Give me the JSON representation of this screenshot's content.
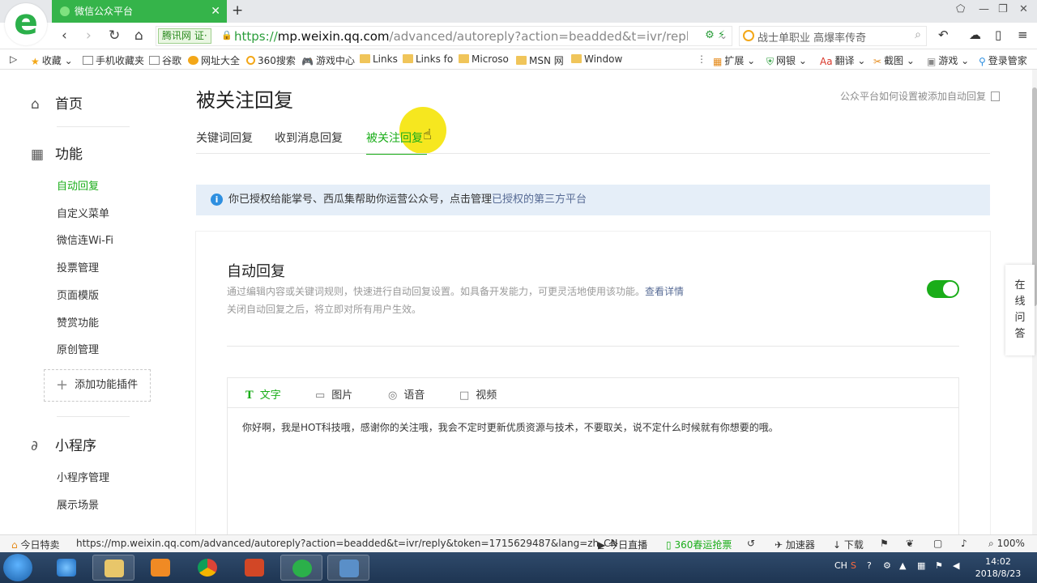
{
  "browser": {
    "tab_title": "微信公众平台",
    "site_badge": "腾讯网 证·",
    "url_scheme": "https://",
    "url_host": "mp.weixin.qq.com",
    "url_path": "/advanced/autoreply?action=beadded&t=ivr/reply&tc",
    "search_text": "战士单职业 高爆率传奇",
    "bookmarks": [
      "收藏",
      "手机收藏夹",
      "谷歌",
      "网址大全",
      "360搜索",
      "游戏中心",
      "Links",
      "Links fo",
      "Microso",
      "MSN 网",
      "Window"
    ],
    "right_bookmarks": [
      "扩展",
      "网银",
      "翻译",
      "截图",
      "游戏",
      "登录管家"
    ]
  },
  "sidebar": {
    "home": "首页",
    "function": "功能",
    "function_items": [
      "自动回复",
      "自定义菜单",
      "微信连Wi-Fi",
      "投票管理",
      "页面模版",
      "赞赏功能",
      "原创管理"
    ],
    "add_plugin": "添加功能插件",
    "miniprogram": "小程序",
    "miniprogram_items": [
      "小程序管理",
      "展示场景"
    ]
  },
  "main": {
    "title": "被关注回复",
    "help_link": "公众平台如何设置被添加自动回复",
    "tabs": [
      "关键词回复",
      "收到消息回复",
      "被关注回复"
    ],
    "notice_text": "你已授权给能掌号、西瓜集帮助你运营公众号，点击管理",
    "notice_link": "已授权的第三方平台",
    "section_title": "自动回复",
    "desc_line1": "通过编辑内容或关键词规则，快速进行自动回复设置。如具备开发能力，可更灵活地使用该功能。",
    "desc_link": "查看详情",
    "desc_line2": "关闭自动回复之后，将立即对所有用户生效。",
    "toggle_on": true,
    "editor_tabs": [
      "文字",
      "图片",
      "语音",
      "视频"
    ],
    "editor_text": "你好啊，我是HOT科技哦，感谢你的关注哦，我会不定时更新优质资源与技术，不要取关，说不定什么时候就有你想要的哦。",
    "float_service": [
      "在",
      "线",
      "问",
      "答"
    ]
  },
  "status": {
    "left": "今日特卖",
    "url": "https://mp.weixin.qq.com/advanced/autoreply?action=beadded&t=ivr/reply&token=1715629487&lang=zh_CN",
    "live": "今日直播",
    "ticket": "360春运抢票",
    "accelerator": "加速器",
    "download": "下载",
    "zoom": "100%"
  },
  "taskbar": {
    "time": "14:02",
    "date": "2018/8/23",
    "ime": "CH"
  },
  "colors": {
    "accent": "#1aad19",
    "tab_green": "#35b44a",
    "link": "#576b95",
    "notice_bg": "#e5eef8"
  }
}
